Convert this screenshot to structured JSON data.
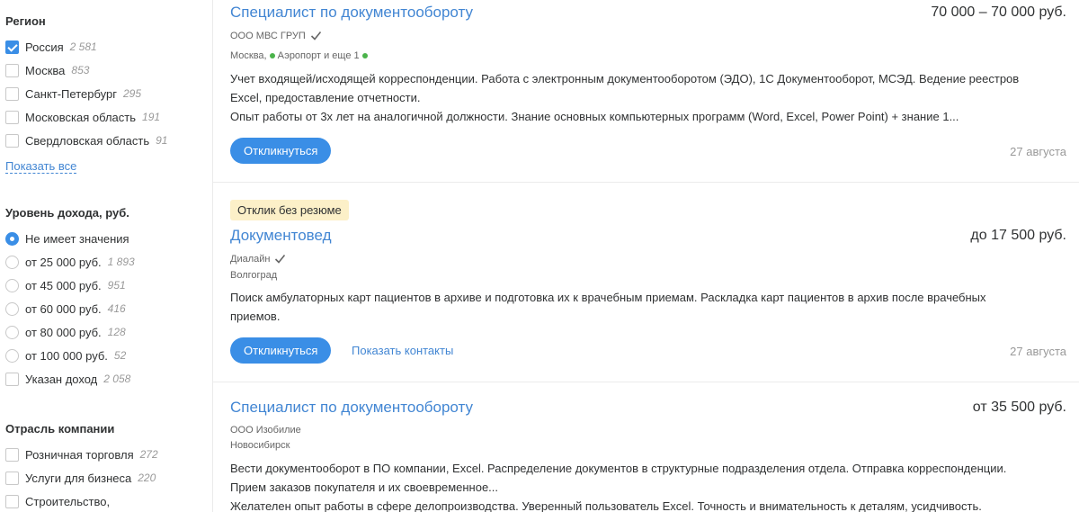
{
  "filters": {
    "region": {
      "title": "Регион",
      "options": [
        {
          "label": "Россия",
          "count": "2 581",
          "checked": true
        },
        {
          "label": "Москва",
          "count": "853",
          "checked": false
        },
        {
          "label": "Санкт-Петербург",
          "count": "295",
          "checked": false
        },
        {
          "label": "Московская область",
          "count": "191",
          "checked": false
        },
        {
          "label": "Свердловская область",
          "count": "91",
          "checked": false
        }
      ],
      "show_all": "Показать все"
    },
    "income": {
      "title": "Уровень дохода, руб.",
      "options": [
        {
          "label": "Не имеет значения",
          "count": "",
          "checked": true
        },
        {
          "label": "от 25 000 руб.",
          "count": "1 893",
          "checked": false
        },
        {
          "label": "от 45 000 руб.",
          "count": "951",
          "checked": false
        },
        {
          "label": "от 60 000 руб.",
          "count": "416",
          "checked": false
        },
        {
          "label": "от 80 000 руб.",
          "count": "128",
          "checked": false
        },
        {
          "label": "от 100 000 руб.",
          "count": "52",
          "checked": false
        }
      ],
      "specified": {
        "label": "Указан доход",
        "count": "2 058",
        "checked": false
      }
    },
    "industry": {
      "title": "Отрасль компании",
      "options": [
        {
          "label": "Розничная торговля",
          "count": "272",
          "checked": false
        },
        {
          "label": "Услуги для бизнеса",
          "count": "220",
          "checked": false
        },
        {
          "label": "Строительство,",
          "count": "",
          "checked": false
        }
      ]
    }
  },
  "vacancies": [
    {
      "title": "Специалист по документообороту",
      "salary": "70 000 – 70 000 руб.",
      "company": "ООО МВС ГРУП",
      "city": "Москва,",
      "metro": "Аэропорт и еще 1",
      "desc": [
        "Учет входящей/исходящей корреспонденции. Работа с электронным документооборотом (ЭДО), 1С Документооборот, МСЭД. Ведение реестров",
        "Excel, предоставление отчетности.",
        "Опыт работы от 3х лет на аналогичной должности. Знание основных компьютерных программ (Word, Excel, Power Point) + знание 1..."
      ],
      "respond": "Откликнуться",
      "date": "27 августа"
    },
    {
      "badge": "Отклик без резюме",
      "title": "Документовед",
      "salary": "до 17 500 руб.",
      "company": "Диалайн",
      "city": "Волгоград",
      "desc": [
        "Поиск амбулаторных карт пациентов в архиве и подготовка их к врачебным приемам. Раскладка карт пациентов в архив после врачебных",
        "приемов."
      ],
      "respond": "Откликнуться",
      "contacts": "Показать контакты",
      "date": "27 августа"
    },
    {
      "title": "Специалист по документообороту",
      "salary": "от 35 500 руб.",
      "company": "ООО Изобилие",
      "city": "Новосибирск",
      "desc": [
        "Вести документооборот в ПО компании, Excel. Распределение документов в структурные подразделения отдела. Отправка корреспонденции.",
        "Прием заказов покупателя и их своевременное...",
        "Желателен опыт работы в сфере делопроизводства. Уверенный пользователь Excel. Точность и внимательность к деталям, усидчивость."
      ]
    }
  ],
  "colors": {
    "accent": "#3a8ee6",
    "link": "#4286d3",
    "badge": "#fcf0c8",
    "metro": "#4bb34b"
  }
}
